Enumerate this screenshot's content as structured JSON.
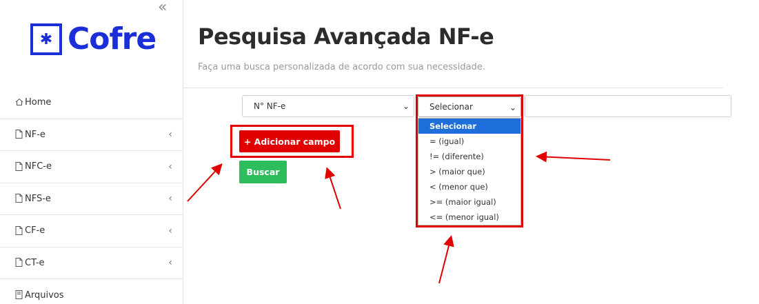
{
  "sidebar": {
    "logo_text": "Cofre",
    "items": [
      {
        "label": "Home",
        "icon": "home-icon",
        "has_chevron": false
      },
      {
        "label": "NF-e",
        "icon": "document-icon",
        "has_chevron": true
      },
      {
        "label": "NFC-e",
        "icon": "document-icon",
        "has_chevron": true
      },
      {
        "label": "NFS-e",
        "icon": "document-icon",
        "has_chevron": true
      },
      {
        "label": "CF-e",
        "icon": "document-icon",
        "has_chevron": true
      },
      {
        "label": "CT-e",
        "icon": "document-icon",
        "has_chevron": true
      },
      {
        "label": "Arquivos",
        "icon": "archive-icon",
        "has_chevron": false
      }
    ]
  },
  "header": {
    "title": "Pesquisa Avançada NF-e",
    "subtitle": "Faça uma busca personalizada de acordo com sua necessidade."
  },
  "search": {
    "field_value": "N° NF-e",
    "operator_value": "Selecionar",
    "value_input": "",
    "operator_options": [
      "Selecionar",
      "= (igual)",
      "!= (diferente)",
      "> (maior que)",
      "< (menor que)",
      ">= (maior igual)",
      "<= (menor igual)"
    ],
    "add_field_label": "+ Adicionar campo",
    "search_label": "Buscar"
  },
  "colors": {
    "brand": "#1a2fd8",
    "add_button": "#e00000",
    "search_button": "#2dbd5c",
    "selected_option": "#1e6fd9",
    "annotation": "#e00000"
  }
}
